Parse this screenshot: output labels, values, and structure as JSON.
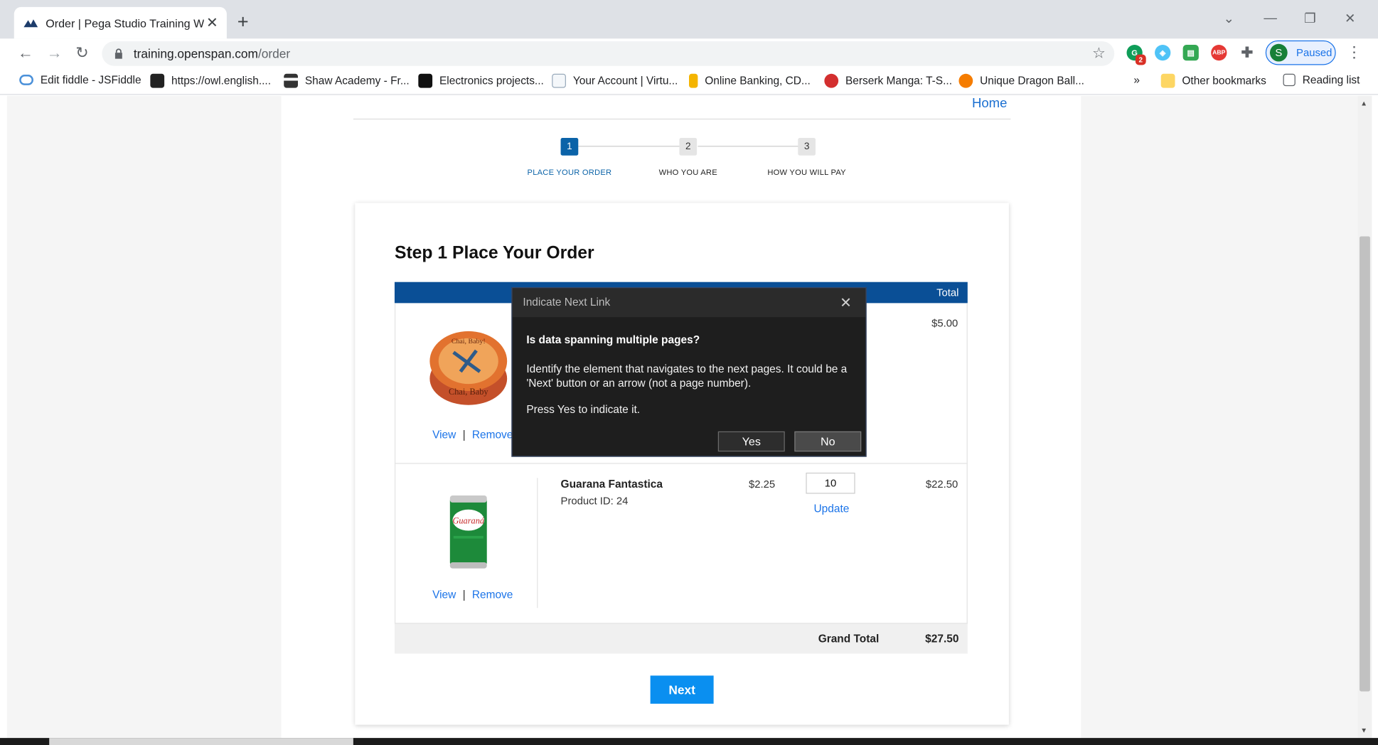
{
  "browser": {
    "tab_title": "Order | Pega Studio Training Web",
    "url_host": "training.openspan.com",
    "url_path": "/order",
    "profile_label": "Paused",
    "profile_initial": "S",
    "extension_badge": "2",
    "bookmarks": [
      {
        "label": "Edit fiddle - JSFiddle",
        "icon": "cloud-icon",
        "color": "#4a90d9"
      },
      {
        "label": "https://owl.english....",
        "icon": "owl-icon",
        "color": "#222222"
      },
      {
        "label": "Shaw Academy - Fr...",
        "icon": "shaw-icon",
        "color": "#333333"
      },
      {
        "label": "Electronics projects...",
        "icon": "electronics-icon",
        "color": "#111111"
      },
      {
        "label": "Your Account | Virtu...",
        "icon": "page-icon",
        "color": "#9ab"
      },
      {
        "label": "Online Banking, CD...",
        "icon": "bank-icon",
        "color": "#f4b400"
      },
      {
        "label": "Berserk Manga: T-S...",
        "icon": "berserk-icon",
        "color": "#d32f2f"
      },
      {
        "label": "Unique Dragon Ball...",
        "icon": "dragonball-icon",
        "color": "#f57c00"
      }
    ],
    "overflow_label": "»",
    "other_bookmarks": "Other bookmarks",
    "reading_list": "Reading list"
  },
  "page": {
    "home_link": "Home",
    "steps": [
      {
        "number": "1",
        "label": "PLACE YOUR ORDER",
        "active": true
      },
      {
        "number": "2",
        "label": "WHO YOU ARE",
        "active": false
      },
      {
        "number": "3",
        "label": "HOW YOU WILL PAY",
        "active": false
      }
    ],
    "title": "Step 1 Place Your Order",
    "table_header_total": "Total",
    "items": [
      {
        "view": "View",
        "separator": "|",
        "remove": "Remove",
        "line_total": "$5.00",
        "image": "chai-baby-tin"
      },
      {
        "name": "Guarana Fantastica",
        "product_id": "Product ID: 24",
        "price": "$2.25",
        "quantity": "10",
        "update": "Update",
        "line_total": "$22.50",
        "view": "View",
        "separator": "|",
        "remove": "Remove",
        "image": "guarana-can"
      }
    ],
    "grand_total_label": "Grand Total",
    "grand_total_value": "$27.50",
    "next_button": "Next"
  },
  "dialog": {
    "title": "Indicate Next Link",
    "question": "Is data spanning multiple pages?",
    "message": "Identify the element that navigates to the next pages. It could be a 'Next' button or an arrow (not a page number).",
    "instruction": "Press Yes to indicate it.",
    "yes_label": "Yes",
    "no_label": "No"
  },
  "colors": {
    "accent": "#0a8ff0",
    "header_blue": "#0a4f96",
    "step_active": "#0b63a8",
    "link": "#1a73e8"
  }
}
